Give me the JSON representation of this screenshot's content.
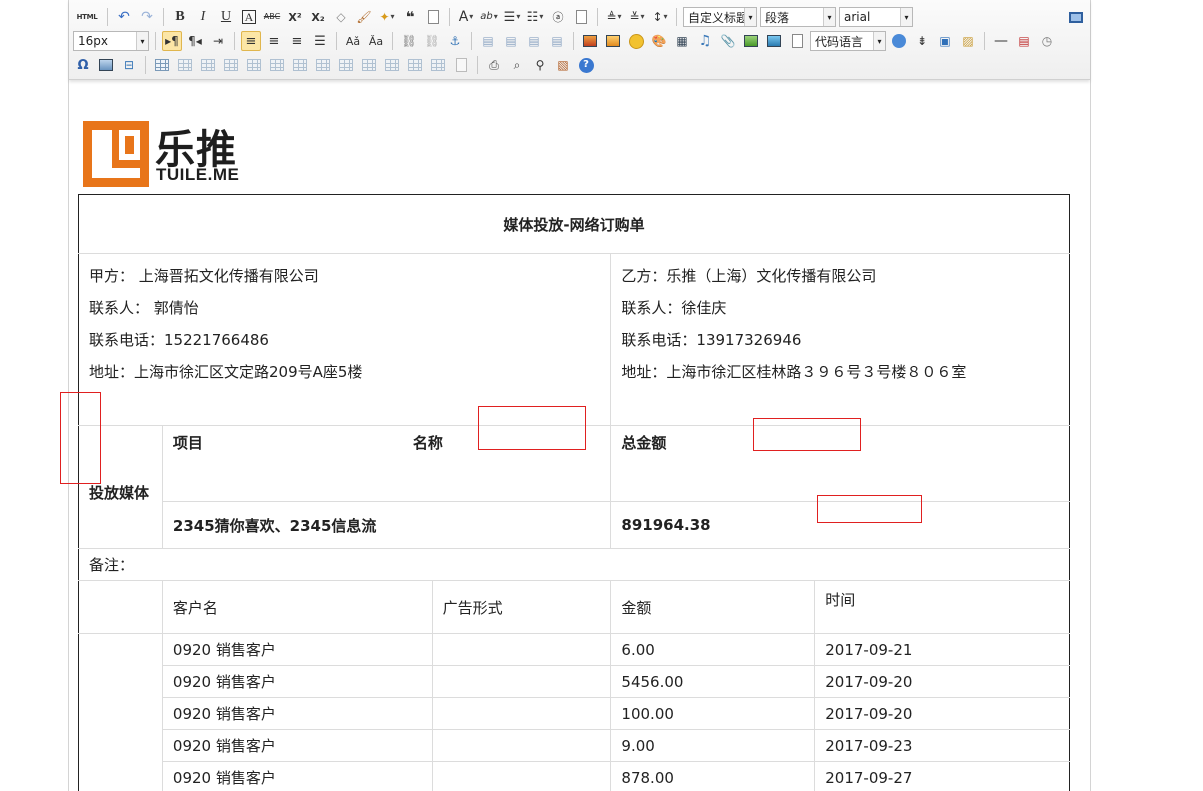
{
  "toolbar": {
    "html_label": "HTML",
    "format_select": "自定义标题",
    "paragraph_select": "段落",
    "font_select": "arial",
    "size_select": "16px",
    "code_language_select": "代码语言"
  },
  "logo": {
    "cn": "乐推",
    "en": "TUILE.ME",
    "color": "#e8751a"
  },
  "order": {
    "title": "媒体投放-网络订购单",
    "party_a": {
      "name": "甲方： 上海晋拓文化传播有限公司",
      "contact": "联系人： 郭倩怡",
      "phone": "联系电话：15221766486",
      "address": "地址：上海市徐汇区文定路209号A座5楼"
    },
    "party_b": {
      "name": "乙方：乐推（上海）文化传播有限公司",
      "contact": "联系人：徐佳庆",
      "phone": "联系电话：13917326946",
      "address": "地址：上海市徐汇区桂林路３９６号３号楼８０６室"
    },
    "media": {
      "label": "投放媒体",
      "col_project": "项目",
      "col_name": "名称",
      "col_total": "总金额",
      "project_value": "2345猜你喜欢、2345信息流",
      "total_value": "891964.38"
    },
    "remark_label": "备注：",
    "detail": {
      "headers": [
        "客户名",
        "广告形式",
        "金额",
        "时间"
      ],
      "rows": [
        [
          "0920 销售客户",
          "",
          "6.00",
          "2017-09-21"
        ],
        [
          "0920 销售客户",
          "",
          "5456.00",
          "2017-09-20"
        ],
        [
          "0920 销售客户",
          "",
          "100.00",
          "2017-09-20"
        ],
        [
          "0920 销售客户",
          "",
          "9.00",
          "2017-09-23"
        ],
        [
          "0920 销售客户",
          "",
          "878.00",
          "2017-09-27"
        ]
      ]
    }
  }
}
